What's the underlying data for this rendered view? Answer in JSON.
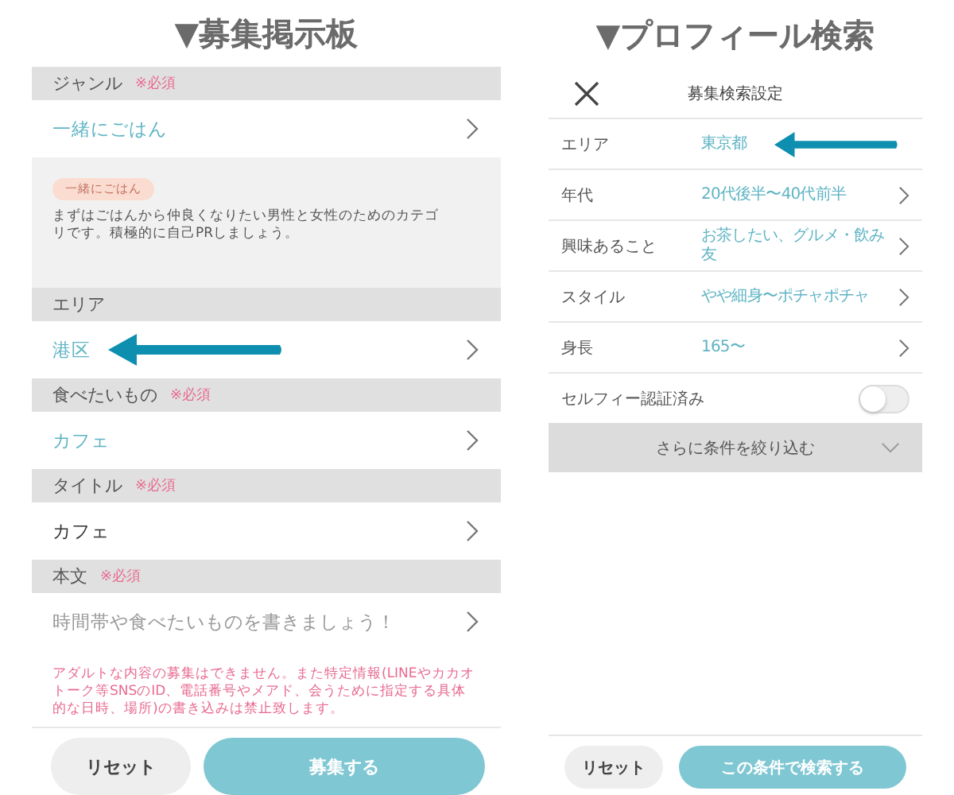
{
  "left": {
    "heading": "▼募集掲示板",
    "sections": [
      {
        "label": "ジャンル",
        "required": "※必須",
        "value": "一緒にごはん",
        "kind": "choice",
        "annotated": false,
        "tag": "一緒にごはん",
        "description": "まずはごはんから仲良くなりたい男性と女性のためのカテゴリです。積極的に自己PRしましょう。"
      },
      {
        "label": "エリア",
        "value": "港区",
        "kind": "choice",
        "annotated": true
      },
      {
        "label": "食べたいもの",
        "required": "※必須",
        "value": "カフェ",
        "kind": "choice",
        "annotated": false
      },
      {
        "label": "タイトル",
        "required": "※必須",
        "value": "カフェ",
        "kind": "text",
        "annotated": false
      },
      {
        "label": "本文",
        "required": "※必須",
        "placeholder": "時間帯や食べたいものを書きましょう！",
        "kind": "placeholder",
        "annotated": false
      }
    ],
    "warning": "アダルトな内容の募集はできません。また特定情報(LINEやカカオトーク等SNSのID、電話番号やメアド、会うために指定する具体的な日時、場所)の書き込みは禁止致します。",
    "buttons": [
      {
        "label": "リセット",
        "kind": "secondary"
      },
      {
        "label": "募集する",
        "kind": "primary"
      }
    ]
  },
  "right": {
    "heading": "▼プロフィール検索",
    "title": "募集検索設定",
    "rows": [
      {
        "label": "エリア",
        "value": "東京都",
        "kind": "select",
        "annotated": true
      },
      {
        "label": "年代",
        "value": "20代後半〜40代前半",
        "kind": "select",
        "annotated": false
      },
      {
        "label": "興味あること",
        "value": "お茶したい、グルメ・飲み友",
        "kind": "select",
        "annotated": false
      },
      {
        "label": "スタイル",
        "value": "やや細身〜ポチャポチャ",
        "kind": "select",
        "annotated": false
      },
      {
        "label": "身長",
        "value": "165〜",
        "kind": "select",
        "annotated": false
      },
      {
        "label": "セルフィー認証済み",
        "kind": "toggle",
        "on": false
      }
    ],
    "more": {
      "label": "さらに条件を絞り込む",
      "expanded": false
    },
    "buttons": [
      {
        "label": "リセット",
        "kind": "secondary"
      },
      {
        "label": "この条件で検索する",
        "kind": "primary"
      }
    ]
  }
}
